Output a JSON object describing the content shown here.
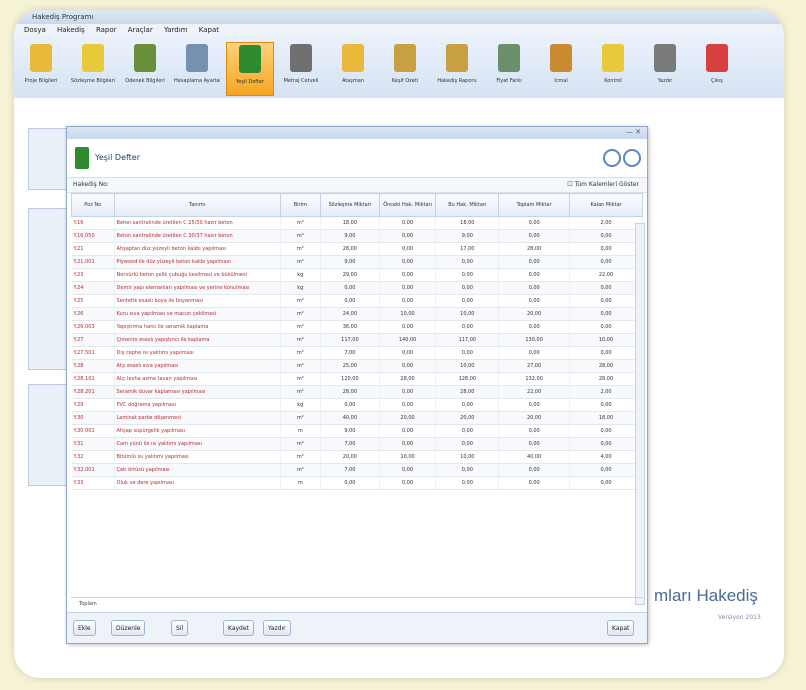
{
  "app_title": "Hakediş Programı",
  "menu": [
    "Dosya",
    "Hakediş",
    "Rapor",
    "Araçlar",
    "Yardım",
    "Kapat"
  ],
  "ribbon": [
    {
      "label": "Proje Bilgileri",
      "icon": "folder-icon",
      "color": "#e8b93a"
    },
    {
      "label": "Sözleşme Bilgileri",
      "icon": "check-icon",
      "color": "#e8c93a"
    },
    {
      "label": "Ödenek Bilgileri",
      "icon": "pen-icon",
      "color": "#6a8f3a"
    },
    {
      "label": "Hesaplama Ayarları",
      "icon": "calculator-icon",
      "color": "#7890b0"
    },
    {
      "label": "Yeşil Defter",
      "icon": "book-icon",
      "color": "#2e8b2e"
    },
    {
      "label": "Metraj Cetveli",
      "icon": "document-icon",
      "color": "#707070"
    },
    {
      "label": "Ataşman",
      "icon": "pencil-icon",
      "color": "#e8b93a"
    },
    {
      "label": "Keşif Özeti",
      "icon": "pencils-icon",
      "color": "#c8a040"
    },
    {
      "label": "Hakediş Raporu",
      "icon": "notebook-icon",
      "color": "#c8a040"
    },
    {
      "label": "Fiyat Farkı",
      "icon": "archive-icon",
      "color": "#6a8f6a"
    },
    {
      "label": "İcmal",
      "icon": "folder-doc-icon",
      "color": "#c98a30"
    },
    {
      "label": "Kontrol",
      "icon": "check-icon",
      "color": "#e8c93a"
    },
    {
      "label": "Yazdır",
      "icon": "printer-icon",
      "color": "#7a7a7a"
    },
    {
      "label": "Çıkış",
      "icon": "exit-icon",
      "color": "#d84040"
    }
  ],
  "window": {
    "title": "Yeşil Defter",
    "filter_label": "Hakediş No:",
    "checkbox_label": "Tüm Kalemleri Göster",
    "columns": [
      "Poz No",
      "Tanımı",
      "Birim",
      "Sözleşme Miktarı",
      "Önceki Hak. Miktarı",
      "Bu Hak. Miktarı",
      "Toplam Miktar",
      "Kalan Miktar"
    ],
    "rows": [
      [
        "Y.16",
        "Beton santralinde üretilen C 25/30 hazır beton",
        "m³",
        "18,00",
        "0,00",
        "18,00",
        "0,00",
        "2,00"
      ],
      [
        "Y.16.050",
        "Beton santralinde üretilen C 30/37 hazır beton",
        "m³",
        "9,00",
        "0,00",
        "9,00",
        "0,00",
        "0,00"
      ],
      [
        "Y.21",
        "Ahşaptan düz yüzeyli beton kalıbı yapılması",
        "m²",
        "28,00",
        "0,00",
        "17,00",
        "28,00",
        "0,00"
      ],
      [
        "Y.21.001",
        "Plywood ile düz yüzeyli beton kalıbı yapılması",
        "m²",
        "9,00",
        "0,00",
        "0,00",
        "0,00",
        "0,00"
      ],
      [
        "Y.23",
        "Nervürlü beton çelik çubuğu kesilmesi ve bükülmesi",
        "kg",
        "29,00",
        "0,00",
        "0,00",
        "0,00",
        "22,00"
      ],
      [
        "Y.24",
        "Demir yapı elemanları yapılması ve yerine konulması",
        "kg",
        "0,00",
        "0,00",
        "0,00",
        "0,00",
        "0,00"
      ],
      [
        "Y.25",
        "Sentetik esaslı boya ile boyanması",
        "m²",
        "0,00",
        "0,00",
        "0,00",
        "0,00",
        "0,00"
      ],
      [
        "Y.26",
        "Kuru sıva yapılması ve macun çekilmesi",
        "m²",
        "24,00",
        "10,00",
        "10,00",
        "20,00",
        "0,00"
      ],
      [
        "Y.26.003",
        "Yapıştırma harcı ile seramik kaplama",
        "m²",
        "36,00",
        "0,00",
        "0,00",
        "0,00",
        "0,00"
      ],
      [
        "Y.27",
        "Çimento esaslı yapıştırıcı ile kaplama",
        "m²",
        "117,00",
        "140,00",
        "117,00",
        "130,00",
        "10,00"
      ],
      [
        "Y.27.501",
        "Dış cephe ısı yalıtımı yapılması",
        "m²",
        "7,00",
        "0,00",
        "0,00",
        "0,00",
        "0,00"
      ],
      [
        "Y.28",
        "Alçı esaslı sıva yapılması",
        "m²",
        "25,00",
        "0,00",
        "10,00",
        "27,00",
        "28,00"
      ],
      [
        "Y.28.101",
        "Alçı levha asma tavan yapılması",
        "m²",
        "120,00",
        "28,00",
        "128,00",
        "132,00",
        "28,00"
      ],
      [
        "Y.28.201",
        "Seramik duvar kaplaması yapılması",
        "m²",
        "28,00",
        "0,00",
        "28,00",
        "22,00",
        "2,00"
      ],
      [
        "Y.29",
        "PVC doğrama yapılması",
        "kg",
        "0,00",
        "0,00",
        "0,00",
        "0,00",
        "0,00"
      ],
      [
        "Y.30",
        "Laminat parke döşenmesi",
        "m²",
        "40,00",
        "20,00",
        "20,00",
        "20,00",
        "18,00"
      ],
      [
        "Y.30.001",
        "Ahşap süpürgelik yapılması",
        "m",
        "9,00",
        "0,00",
        "0,00",
        "0,00",
        "0,00"
      ],
      [
        "Y.31",
        "Cam yünü ile ısı yalıtımı yapılması",
        "m²",
        "7,00",
        "0,00",
        "0,00",
        "0,00",
        "0,00"
      ],
      [
        "Y.32",
        "Bitümlü su yalıtımı yapılması",
        "m²",
        "20,00",
        "10,00",
        "10,00",
        "40,00",
        "4,00"
      ],
      [
        "Y.32.001",
        "Çatı örtüsü yapılması",
        "m²",
        "7,00",
        "0,00",
        "0,00",
        "0,00",
        "0,00"
      ],
      [
        "Y.33",
        "Oluk ve dere yapılması",
        "m",
        "0,00",
        "0,00",
        "0,00",
        "0,00",
        "0,00"
      ]
    ],
    "footer_text": "Toplam",
    "buttons": [
      "Ekle",
      "Düzenle",
      "Sil",
      "Kaydet",
      "Yazdır",
      "Kapat"
    ]
  },
  "background": {
    "big_title": "mları Hakediş",
    "big_sub": "Versiyon 2013"
  }
}
